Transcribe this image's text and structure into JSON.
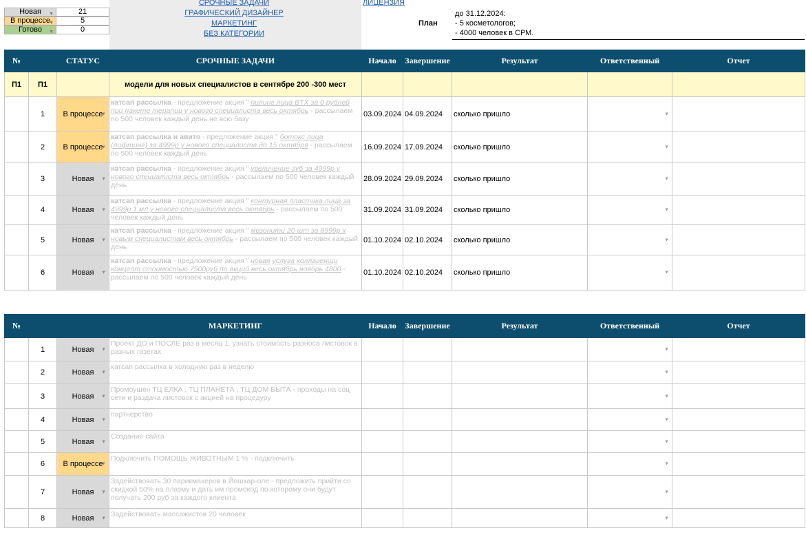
{
  "summary": [
    {
      "label": "Новая",
      "value": "21",
      "color": "#d9d9d9"
    },
    {
      "label": "В процессе",
      "value": "5",
      "color": "#ffd88a"
    },
    {
      "label": "Готово",
      "value": "0",
      "color": "#a9d08e"
    }
  ],
  "links": [
    "СРОЧНЫЕ ЗАДАЧИ",
    "ГРАФИЧЕСКИЙ ДИЗАЙНЕР",
    "МАРКЕТИНГ",
    "БЕЗ КАТЕГОРИИ"
  ],
  "license_link": "ЛИЦЕНЗИЯ",
  "plan": {
    "label": "План",
    "lines": [
      "до 31.12.2024:",
      "- 5 косметологов;",
      "- 4000 человек в СРМ."
    ]
  },
  "urgent": {
    "headers": {
      "num": "№",
      "status": "СТАТУС",
      "title": "СРОЧНЫЕ ЗАДАЧИ",
      "start": "Начало",
      "end": "Завершение",
      "result": "Результат",
      "owner": "Ответственный",
      "report": "Отчет"
    },
    "group": {
      "c1": "П1",
      "c2": "П1",
      "title": "модели для новых специалистов в сентябре 200 -300 мест"
    },
    "rows": [
      {
        "n": "1",
        "status": "В процессе",
        "bold": "катсап рассылка",
        "pre": " - предложение акция \" ",
        "italic": "пилинг лица BTX за 0 рублей при пакете терапии у нового специалиста весь октябрь",
        "post": " - рассылаем по 500 человек каждый день не всю базу",
        "start": "03.09.2024",
        "end": "04.09.2024",
        "result": "сколько пришло"
      },
      {
        "n": "2",
        "status": "В процессе",
        "bold": "катсап рассылка и авито",
        "pre": " - предложение акция \" ",
        "italic": "ботокс лица (лифтинг) за 4999р у нового специалиста до 15 октября",
        "post": " - рассылаем по 500 человек каждый день",
        "start": "16.09.2024",
        "end": "17.09.2024",
        "result": "сколько пришло"
      },
      {
        "n": "3",
        "status": "Новая",
        "bold": "катсап рассылка",
        "pre": " - предложение акция \" ",
        "italic": "увеличение губ за 4999р у нового специалиста весь октябрь",
        "post": " - рассылаем по 500 человек каждый день",
        "start": "28.09.2024",
        "end": "29.09.2024",
        "result": "сколько пришло"
      },
      {
        "n": "4",
        "status": "Новая",
        "bold": "катсап рассылка",
        "pre": " - предложение акция \" ",
        "italic": "контурная пластика лица за 4999р 1 мл у нового специалиста весь октябрь",
        "post": " - рассылаем по 500 человек каждый день",
        "start": "31.09.2024",
        "end": "31.09.2024",
        "result": "сколько пришло"
      },
      {
        "n": "5",
        "status": "Новая",
        "bold": "катсап рассылка",
        "pre": " - предложение акция \" ",
        "italic": "мезонити 20 шт за 8999р к новым специалистам весь октябрь",
        "post": " - рассылаем по 500 человек каждый день",
        "start": "01.10.2024",
        "end": "02.10.2024",
        "result": "сколько пришло"
      },
      {
        "n": "6",
        "status": "Новая",
        "bold": "катсап рассылка",
        "pre": " - предложение акция \" ",
        "italic": "новая услуга коллагенщи концепт стоимостью 7500руб по акций весь октябрь ноябрь 4800",
        "post": " - рассылаем по 500 человек каждый день",
        "start": "01.10.2024",
        "end": "02.10.2024",
        "result": "сколько пришло"
      }
    ]
  },
  "marketing": {
    "headers": {
      "num": "№",
      "title": "МАРКЕТИНГ",
      "start": "Начало",
      "end": "Завершение",
      "result": "Результат",
      "owner": "Ответственный",
      "report": "Отчет"
    },
    "rows": [
      {
        "n": "1",
        "status": "Новая",
        "text": "Проект ДО и ПОСЛЕ раз в месяц 1. узнать стоимость разноса листовок в разных газетах"
      },
      {
        "n": "2",
        "status": "Новая",
        "text": "катсап рассылка в холодную раз в неделю"
      },
      {
        "n": "3",
        "status": "Новая",
        "text": "Промоушен ТЦ ЕЛКА , ТЦ ПЛАНЕТА , ТЦ ДОМ БЫТА - проходы на соц сети и раздача листовок с акцией на процедуру"
      },
      {
        "n": "4",
        "status": "Новая",
        "text": "партнерство"
      },
      {
        "n": "5",
        "status": "Новая",
        "text": "Создание сайта"
      },
      {
        "n": "6",
        "status": "В процессе",
        "text": "Подключить ПОМОЩЬ ЖИВОТНЫМ 1 % - подключить"
      },
      {
        "n": "7",
        "status": "Новая",
        "text": "Задействовать 30 парикмахеров в Йошкар-оле - предложить прийти со скидкой 50% на плазму и дать им промокод по которому они будут получать 200 руб за каждого клиента"
      },
      {
        "n": "8",
        "status": "Новая",
        "text": "Задействовать массажистов 20 человек"
      }
    ]
  }
}
